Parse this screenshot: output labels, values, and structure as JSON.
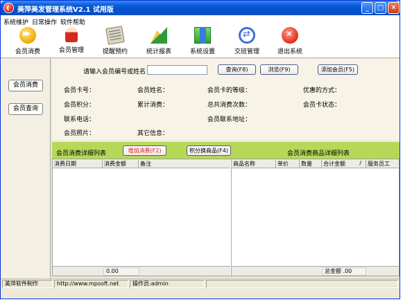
{
  "window": {
    "title": "美萍美发管理系统V2.1 试用版",
    "minimize": "_",
    "maximize": "□",
    "close": "✕"
  },
  "menu": [
    "系统维护",
    "日常操作",
    "软件帮助"
  ],
  "toolbar": [
    {
      "label": "会员消费",
      "icon": "fast-forward-icon"
    },
    {
      "label": "会员管理",
      "icon": "member-icon"
    },
    {
      "label": "提醒预约",
      "icon": "notepad-icon"
    },
    {
      "label": "统计报表",
      "icon": "stats-icon"
    },
    {
      "label": "系统设置",
      "icon": "settings-icon"
    },
    {
      "label": "交班管理",
      "icon": "shift-icon"
    },
    {
      "label": "退出系统",
      "icon": "exit-icon"
    }
  ],
  "sidebar": {
    "consume": "会员消费",
    "query": "会员查询"
  },
  "search": {
    "prompt": "请输入会员编号或姓名",
    "value": "",
    "query_btn": "查询(F8)",
    "browse_btn": "浏览(F9)",
    "add_btn": "添加会员(F5)"
  },
  "fields": {
    "card_no": "会员卡号：",
    "name": "会员姓名：",
    "card_level": "会员卡的等级：",
    "discount": "优惠的方式：",
    "points": "会员积分：",
    "total_spent": "累计消费：",
    "visit_count": "总共消费次数：",
    "card_status": "会员卡状态：",
    "phone": "联系电话：",
    "address": "会员联系地址：",
    "photo": "会员照片：",
    "other": "其它信息："
  },
  "green_bar": {
    "left_title": "会员消费详细列表",
    "add_consume_btn": "增加消费(F2)",
    "points_btn": "积分换商品(F4)",
    "right_title": "会员消费商品详细列表"
  },
  "left_table": {
    "columns": [
      "消费日期",
      "消费金额",
      "备注"
    ],
    "footer_value": "0.00"
  },
  "right_table": {
    "columns": [
      "商品名称",
      "单价",
      "数量",
      "合计金额",
      "服务员工"
    ],
    "footer_label": "总金额",
    "footer_value": ".00",
    "sort_mark": "/"
  },
  "status": {
    "company": "美萍软件制作",
    "url": "http://www.mpsoft.net",
    "operator": "操作员:admin"
  },
  "colors": {
    "titlebar": "#0a5fd8",
    "green_bar": "#b7d857",
    "red_text": "#e01010"
  }
}
